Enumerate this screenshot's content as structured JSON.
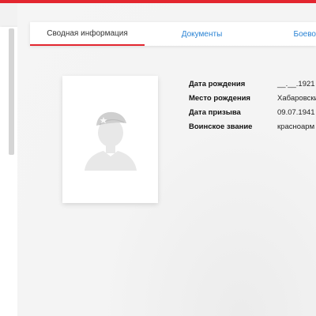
{
  "colors": {
    "accent": "#e3262f",
    "link": "#2a83d4"
  },
  "tabs": [
    {
      "label": "Сводная информация",
      "active": true
    },
    {
      "label": "Документы",
      "active": false
    },
    {
      "label": "Боево",
      "active": false
    }
  ],
  "photo": {
    "icon": "soldier-placeholder-icon"
  },
  "info": {
    "birth_date_label": "Дата рождения",
    "birth_date_value": "__.__.1921",
    "birth_place_label": "Место рождения",
    "birth_place_value": "Хабаровски",
    "draft_date_label": "Дата призыва",
    "draft_date_value": "09.07.1941",
    "rank_label": "Воинское звание",
    "rank_value": "красноарм"
  }
}
